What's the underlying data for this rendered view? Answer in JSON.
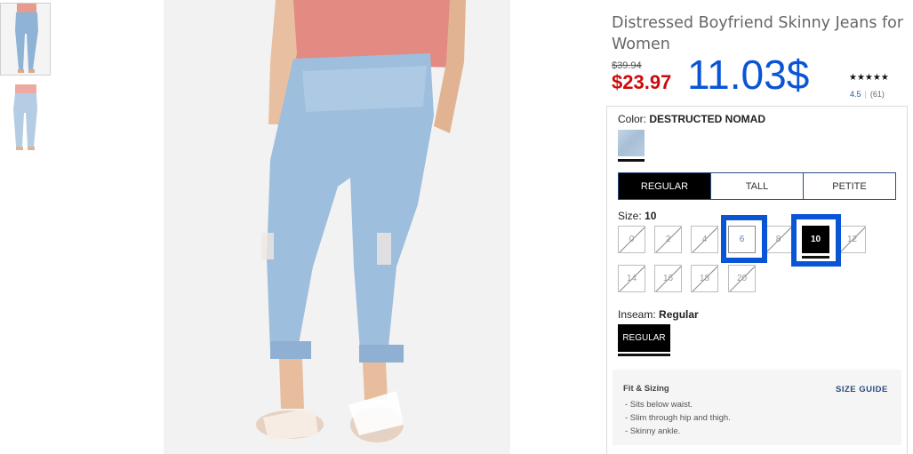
{
  "product": {
    "title": "Distressed Boyfriend Skinny Jeans for Women",
    "price_original": "$39.94",
    "price_sale": "$23.97",
    "price_annotation": "11.03$",
    "stars": "★★★★★",
    "rating": "4.5",
    "review_count": "(61)"
  },
  "color": {
    "label": "Color: ",
    "value": "DESTRUCTED NOMAD"
  },
  "fit_tabs": [
    {
      "label": "REGULAR",
      "active": true
    },
    {
      "label": "TALL",
      "active": false
    },
    {
      "label": "PETITE",
      "active": false
    }
  ],
  "size": {
    "label": "Size: ",
    "value": "10",
    "options": [
      {
        "label": "0",
        "state": "unavailable"
      },
      {
        "label": "2",
        "state": "unavailable"
      },
      {
        "label": "4",
        "state": "unavailable"
      },
      {
        "label": "6",
        "state": "available"
      },
      {
        "label": "8",
        "state": "unavailable"
      },
      {
        "label": "10",
        "state": "selected"
      },
      {
        "label": "12",
        "state": "unavailable"
      },
      {
        "label": "14",
        "state": "unavailable"
      },
      {
        "label": "16",
        "state": "unavailable"
      },
      {
        "label": "18",
        "state": "unavailable"
      },
      {
        "label": "20",
        "state": "unavailable"
      }
    ]
  },
  "inseam": {
    "label": "Inseam: ",
    "value": "Regular",
    "button": "REGULAR"
  },
  "fit_sizing": {
    "title": "Fit & Sizing",
    "guide_link": "SIZE GUIDE",
    "bullets": [
      "- Sits below waist.",
      "- Slim through hip and thigh.",
      "- Skinny ankle."
    ]
  },
  "colors": {
    "sale_red": "#cc0b0b",
    "annotation_blue": "#0a55d6",
    "tab_border": "#2d4d7d",
    "link_blue": "#2a4a7f"
  },
  "icons": [
    "thumbnail-image",
    "product-image",
    "color-swatch"
  ]
}
